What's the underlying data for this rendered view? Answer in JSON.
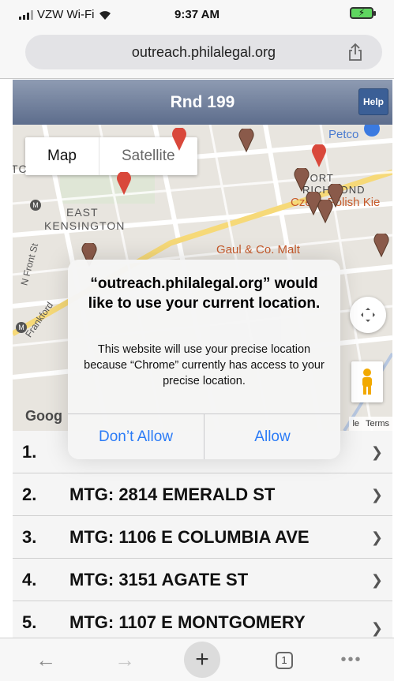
{
  "status_bar": {
    "carrier": "VZW Wi-Fi",
    "time": "9:37 AM"
  },
  "browser": {
    "url": "outreach.philalegal.org"
  },
  "app": {
    "title": "Rnd 199",
    "help_label": "Help"
  },
  "map": {
    "type_options": [
      "Map",
      "Satellite"
    ],
    "labels": {
      "east": "EAST",
      "kensington": "KENSINGTON",
      "n_front_st": "N Front St",
      "frankford": "Frankford",
      "port_richmond": "PORT RICHMOND",
      "tc": "TC",
      "czerw_polish": "Czerw Polish Kie",
      "gaul_malt": "Gaul & Co. Malt",
      "petco": "Petco"
    },
    "pin_label": "TT",
    "google": "Goog",
    "legal": [
      "le",
      "Terms"
    ]
  },
  "list": {
    "items": [
      {
        "num": "1.",
        "text": ""
      },
      {
        "num": "2.",
        "text": "MTG: 2814 EMERALD ST"
      },
      {
        "num": "3.",
        "text": "MTG: 1106 E COLUMBIA AVE"
      },
      {
        "num": "4.",
        "text": "MTG: 3151 AGATE ST"
      },
      {
        "num": "5.",
        "text": "MTG: 1107 E MONTGOMERY"
      }
    ]
  },
  "alert": {
    "title": "“outreach.philalegal.org” would like to use your current location.",
    "message": "This website will use your precise location because “Chrome” currently has access to your precise location.",
    "deny_label": "Don’t Allow",
    "allow_label": "Allow"
  },
  "toolbar": {
    "tab_count": "1"
  },
  "colors": {
    "alert_button": "#2b7bf6",
    "titlebar_top": "#8e9bb2",
    "titlebar_bottom": "#5d6d8c",
    "help_button": "#3b5f96"
  }
}
